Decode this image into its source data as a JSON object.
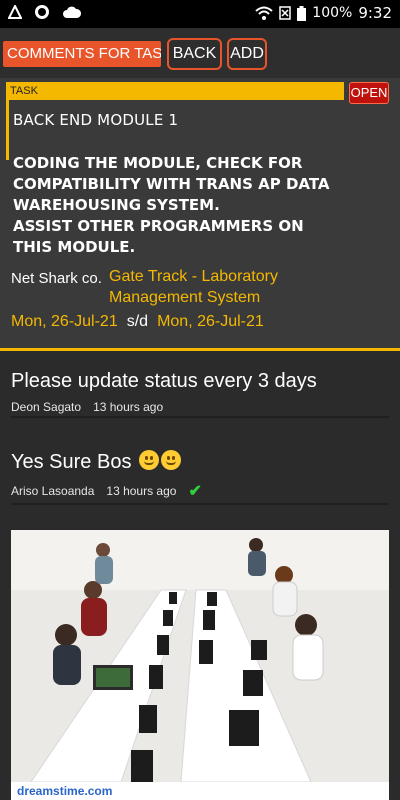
{
  "status_bar": {
    "battery": "100%",
    "time": "9:32"
  },
  "toolbar": {
    "title": "COMMENTS FOR TASK |",
    "back_label": "BACK",
    "add_label": "ADD"
  },
  "task": {
    "label": "TASK",
    "status": "OPEN",
    "title": "BACK END MODULE 1",
    "description_lines": [
      "CODING THE MODULE, CHECK FOR",
      "COMPATIBILITY WITH TRANS AP DATA",
      "WAREHOUSING SYSTEM.",
      "ASSIST OTHER PROGRAMMERS ON",
      "THIS MODULE."
    ],
    "company": "Net Shark co.",
    "project_lines": [
      "Gate Track - Laboratory",
      "Management System"
    ],
    "start_date": "Mon, 26-Jul-21",
    "separator": "s/d",
    "end_date": "Mon, 26-Jul-21"
  },
  "comments": [
    {
      "text": "Please update status every 3 days",
      "author": "Deon Sagato",
      "time": "13 hours ago"
    },
    {
      "text": "Yes Sure Bos",
      "author": "Ariso Lasoanda",
      "time": "13 hours ago"
    }
  ],
  "photo": {
    "watermark": "dreamstime.com"
  },
  "colors": {
    "accent": "#e8552a",
    "highlight": "#f5b800",
    "status_open": "#c0120c",
    "read_check": "#2fd03a"
  }
}
